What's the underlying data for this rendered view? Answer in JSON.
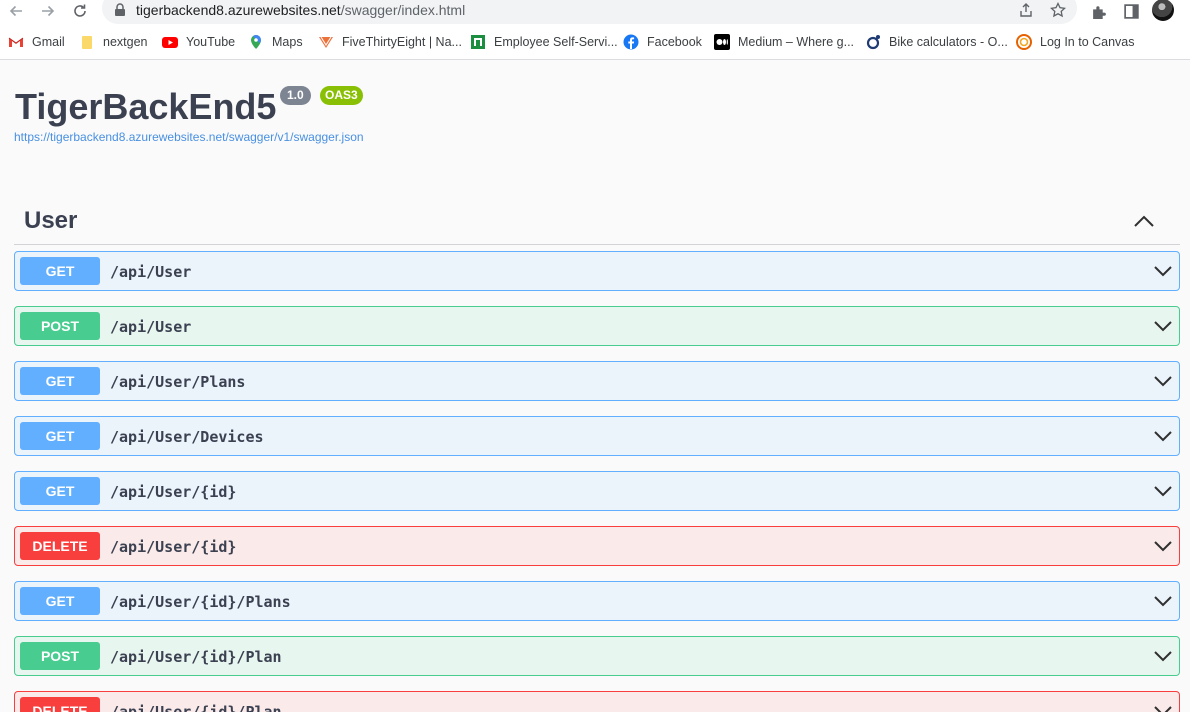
{
  "browser": {
    "url_host": "tigerbackend8.azurewebsites.net",
    "url_path": "/swagger/index.html",
    "icons": {
      "back": "arrow-left-icon",
      "forward": "arrow-right-icon",
      "reload": "reload-icon",
      "lock": "lock-icon",
      "share": "share-icon",
      "bookmark": "star-icon",
      "extensions": "puzzle-icon",
      "side_panel": "side-panel-icon",
      "profile": "avatar"
    }
  },
  "bookmarks": [
    {
      "label": "Gmail",
      "icon": "gmail-icon"
    },
    {
      "label": "nextgen",
      "icon": "folder-icon"
    },
    {
      "label": "YouTube",
      "icon": "youtube-icon"
    },
    {
      "label": "Maps",
      "icon": "maps-icon"
    },
    {
      "label": "FiveThirtyEight | Na...",
      "icon": "fivethirtyeight-icon"
    },
    {
      "label": "Employee Self-Servi...",
      "icon": "employee-icon"
    },
    {
      "label": "Facebook",
      "icon": "facebook-icon"
    },
    {
      "label": "Medium – Where g...",
      "icon": "medium-icon"
    },
    {
      "label": "Bike calculators - O...",
      "icon": "bike-icon"
    },
    {
      "label": "Log In to Canvas",
      "icon": "canvas-icon"
    }
  ],
  "api": {
    "title": "TigerBackEnd5",
    "version": "1.0",
    "spec": "OAS3",
    "spec_url": "https://tigerbackend8.azurewebsites.net/swagger/v1/swagger.json"
  },
  "tag": {
    "name": "User",
    "expanded": true
  },
  "operations": [
    {
      "method": "GET",
      "path": "/api/User"
    },
    {
      "method": "POST",
      "path": "/api/User"
    },
    {
      "method": "GET",
      "path": "/api/User/Plans"
    },
    {
      "method": "GET",
      "path": "/api/User/Devices"
    },
    {
      "method": "GET",
      "path": "/api/User/{id}"
    },
    {
      "method": "DELETE",
      "path": "/api/User/{id}"
    },
    {
      "method": "GET",
      "path": "/api/User/{id}/Plans"
    },
    {
      "method": "POST",
      "path": "/api/User/{id}/Plan"
    },
    {
      "method": "DELETE",
      "path": "/api/User/{id}/Plan"
    }
  ],
  "colors": {
    "get": "#61affe",
    "post": "#49cc90",
    "delete": "#f93e3e",
    "text": "#3b4151",
    "link": "#4990e2"
  }
}
